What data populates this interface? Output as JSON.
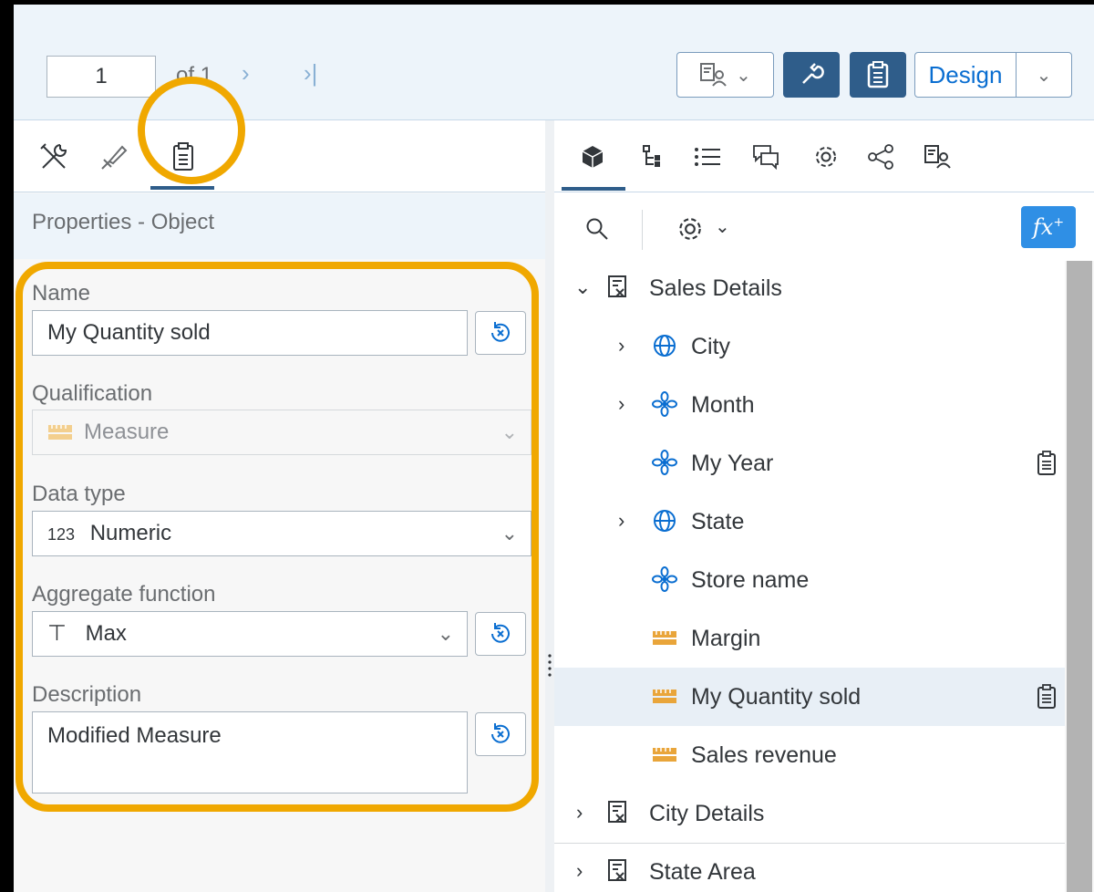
{
  "toolbar": {
    "page_value": "1",
    "of_label": "of 1",
    "design_label": "Design"
  },
  "left_panel": {
    "title": "Properties - Object",
    "fields": {
      "name_label": "Name",
      "name_value": "My Quantity sold",
      "qualification_label": "Qualification",
      "qualification_value": "Measure",
      "data_type_label": "Data type",
      "data_type_prefix": "123",
      "data_type_value": "Numeric",
      "aggregate_label": "Aggregate function",
      "aggregate_value": "Max",
      "description_label": "Description",
      "description_value": "Modified Measure"
    }
  },
  "tree": {
    "items": [
      {
        "label": "Sales Details",
        "icon": "folder-icon",
        "expanded": true
      },
      {
        "label": "City",
        "icon": "globe-icon"
      },
      {
        "label": "Month",
        "icon": "dimension-icon"
      },
      {
        "label": "My Year",
        "icon": "dimension-icon"
      },
      {
        "label": "State",
        "icon": "globe-icon"
      },
      {
        "label": "Store name",
        "icon": "dimension-icon"
      },
      {
        "label": "Margin",
        "icon": "measure-icon"
      },
      {
        "label": "My Quantity sold",
        "icon": "measure-icon",
        "selected": true
      },
      {
        "label": "Sales revenue",
        "icon": "measure-icon"
      },
      {
        "label": "City Details",
        "icon": "folder-icon"
      },
      {
        "label": "State Area",
        "icon": "folder-icon"
      }
    ]
  },
  "colors": {
    "accent": "#2f5d8a",
    "highlight": "#f0a800",
    "measure_icon": "#e9a53a",
    "dimension_icon": "#0a6ed1"
  }
}
